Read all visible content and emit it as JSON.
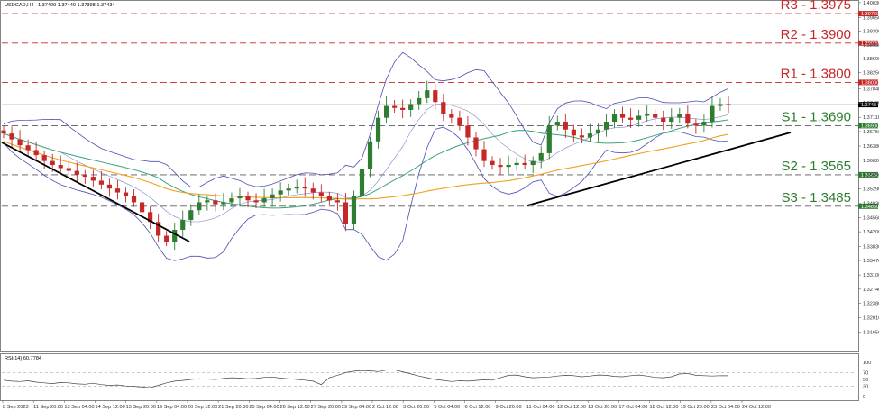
{
  "header": {
    "symbol": "USDCAD,H4",
    "ohlc": "1.37409 1.37440 1.37398 1.37434"
  },
  "rsi_header": {
    "label": "RSI(14) 60.7784"
  },
  "colors": {
    "candle_up": "#2e7d32",
    "candle_down": "#c62828",
    "resistance": "#c62828",
    "support": "#2e7d32",
    "bollinger": "#4a4fb0",
    "ma_fast": "#3aa37a",
    "ma_slow": "#f0a020",
    "trendline": "#000000",
    "grid": "#dddddd"
  },
  "levels": [
    {
      "name": "R3",
      "text": "R3 - 1.3975",
      "value": 1.3975,
      "price_tag": "1.39750",
      "kind": "resistance"
    },
    {
      "name": "R2",
      "text": "R2 - 1.3900",
      "value": 1.39,
      "price_tag": "1.39000",
      "kind": "resistance"
    },
    {
      "name": "R1",
      "text": "R1 - 1.3800",
      "value": 1.38,
      "price_tag": "1.38000",
      "kind": "resistance"
    },
    {
      "name": "S1",
      "text": "S1 - 1.3690",
      "value": 1.369,
      "price_tag": "1.36900",
      "kind": "support"
    },
    {
      "name": "S2",
      "text": "S2 - 1.3565",
      "value": 1.3565,
      "price_tag": "1.35650",
      "kind": "support"
    },
    {
      "name": "S3",
      "text": "S3 - 1.3485",
      "value": 1.3485,
      "price_tag": "1.34850",
      "kind": "support"
    }
  ],
  "current_price": {
    "value": 1.37434,
    "price_tag": "1.37434"
  },
  "chart_data": {
    "type": "line",
    "ylim": [
      1.312,
      1.4005
    ],
    "price_ticks": [
      "1.40030",
      "1.39650",
      "1.39300",
      "1.38950",
      "1.38600",
      "1.38250",
      "1.37840",
      "1.37480",
      "1.37110",
      "1.36750",
      "1.36380",
      "1.36020",
      "1.35650",
      "1.35290",
      "1.34920",
      "1.34560",
      "1.34200",
      "1.33830",
      "1.33470",
      "1.33100",
      "1.32740",
      "1.32380",
      "1.32010",
      "1.31650"
    ],
    "price_tick_values": [
      1.4003,
      1.3965,
      1.393,
      1.3895,
      1.386,
      1.3825,
      1.3784,
      1.3748,
      1.3711,
      1.3675,
      1.3638,
      1.3602,
      1.3565,
      1.3529,
      1.3492,
      1.3456,
      1.342,
      1.3383,
      1.3347,
      1.331,
      1.3274,
      1.3238,
      1.3201,
      1.3165
    ],
    "rsi_ticks": [
      "100",
      "70",
      "50",
      "30",
      "0"
    ],
    "rsi_tick_values": [
      100,
      70,
      50,
      30,
      0
    ],
    "x_labels": [
      "8 Sep 2023",
      "11 Sep 20:00",
      "13 Sep 04:00",
      "14 Sep 12:00",
      "15 Sep 20:00",
      "19 Sep 04:00",
      "20 Sep 12:00",
      "21 Sep 20:00",
      "25 Sep 04:00",
      "26 Sep 12:00",
      "27 Sep 20:00",
      "29 Sep 04:00",
      "2 Oct 12:00",
      "3 Oct 20:00",
      "5 Oct 04:00",
      "6 Oct 12:00",
      "9 Oct 20:00",
      "11 Oct 04:00",
      "12 Oct 12:00",
      "13 Oct 20:00",
      "17 Oct 04:00",
      "18 Oct 12:00",
      "19 Oct 20:00",
      "23 Oct 04:00",
      "24 Oct 12:00"
    ],
    "close_series": [
      1.367,
      1.3655,
      1.364,
      1.3628,
      1.3615,
      1.36,
      1.359,
      1.3582,
      1.3575,
      1.3565,
      1.356,
      1.355,
      1.354,
      1.353,
      1.352,
      1.351,
      1.3495,
      1.347,
      1.3445,
      1.341,
      1.3395,
      1.3425,
      1.345,
      1.3475,
      1.3495,
      1.35,
      1.349,
      1.3495,
      1.3505,
      1.351,
      1.35,
      1.3495,
      1.3505,
      1.3515,
      1.3525,
      1.353,
      1.3535,
      1.353,
      1.352,
      1.351,
      1.35,
      1.3495,
      1.344,
      1.351,
      1.358,
      1.365,
      1.371,
      1.374,
      1.3735,
      1.373,
      1.3745,
      1.376,
      1.378,
      1.375,
      1.372,
      1.371,
      1.369,
      1.366,
      1.363,
      1.36,
      1.359,
      1.3585,
      1.359,
      1.3595,
      1.359,
      1.36,
      1.362,
      1.369,
      1.37,
      1.368,
      1.3665,
      1.366,
      1.367,
      1.368,
      1.37,
      1.372,
      1.371,
      1.3705,
      1.3715,
      1.372,
      1.371,
      1.37,
      1.371,
      1.372,
      1.3695,
      1.369,
      1.37,
      1.374,
      1.3745,
      1.37434
    ],
    "rsi_series": [
      48,
      45,
      44,
      46,
      42,
      40,
      38,
      41,
      40,
      37,
      36,
      39,
      35,
      33,
      34,
      31,
      30,
      28,
      26,
      33,
      40,
      45,
      47,
      50,
      52,
      51,
      50,
      53,
      55,
      54,
      52,
      53,
      56,
      57,
      54,
      52,
      50,
      48,
      45,
      35,
      55,
      62,
      70,
      74,
      76,
      75,
      73,
      77,
      78,
      72,
      66,
      60,
      55,
      50,
      47,
      44,
      46,
      45,
      47,
      49,
      48,
      55,
      62,
      63,
      58,
      55,
      56,
      57,
      60,
      62,
      61,
      58,
      60,
      63,
      62,
      59,
      58,
      61,
      63,
      60,
      56,
      55,
      58,
      66,
      67,
      62,
      61,
      60,
      61,
      60.78
    ]
  }
}
